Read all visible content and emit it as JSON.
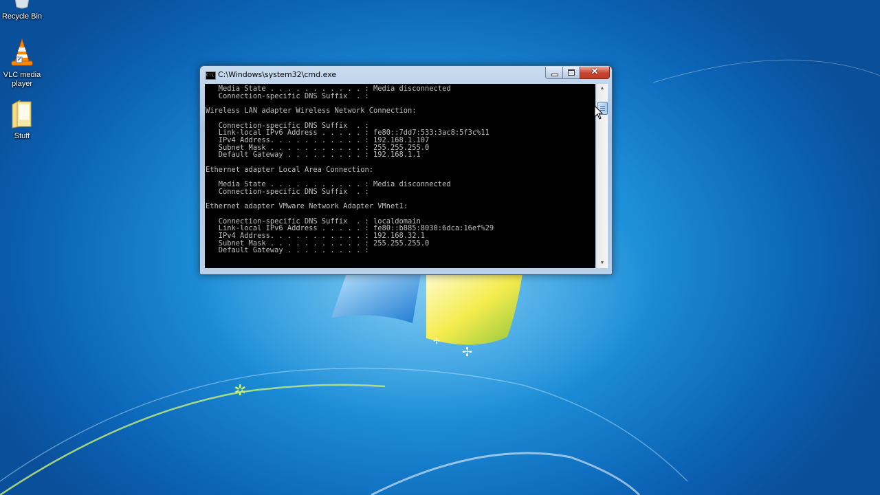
{
  "desktop_icons": [
    {
      "label": "Recycle Bin",
      "icon": "recycle-bin-icon"
    },
    {
      "label": "VLC media player",
      "icon": "vlc-cone-icon"
    },
    {
      "label": "Stuff",
      "icon": "folder-icon"
    }
  ],
  "window": {
    "title": "C:\\Windows\\system32\\cmd.exe",
    "icon": "console-icon",
    "console_lines": [
      "   Media State . . . . . . . . . . . : Media disconnected",
      "   Connection-specific DNS Suffix  . :",
      "",
      "Wireless LAN adapter Wireless Network Connection:",
      "",
      "   Connection-specific DNS Suffix  . :",
      "   Link-local IPv6 Address . . . . . : fe80::7dd7:533:3ac8:5f3c%11",
      "   IPv4 Address. . . . . . . . . . . : 192.168.1.107",
      "   Subnet Mask . . . . . . . . . . . : 255.255.255.0",
      "   Default Gateway . . . . . . . . . : 192.168.1.1",
      "",
      "Ethernet adapter Local Area Connection:",
      "",
      "   Media State . . . . . . . . . . . : Media disconnected",
      "   Connection-specific DNS Suffix  . :",
      "",
      "Ethernet adapter VMware Network Adapter VMnet1:",
      "",
      "   Connection-specific DNS Suffix  . : localdomain",
      "   Link-local IPv6 Address . . . . . : fe80::b885:8030:6dca:16ef%29",
      "   IPv4 Address. . . . . . . . . . . : 192.168.32.1",
      "   Subnet Mask . . . . . . . . . . . : 255.255.255.0",
      "   Default Gateway . . . . . . . . . :"
    ]
  },
  "colors": {
    "console_background": "#000000",
    "console_text": "#c0c0c0",
    "close_button": "#c7432f"
  }
}
